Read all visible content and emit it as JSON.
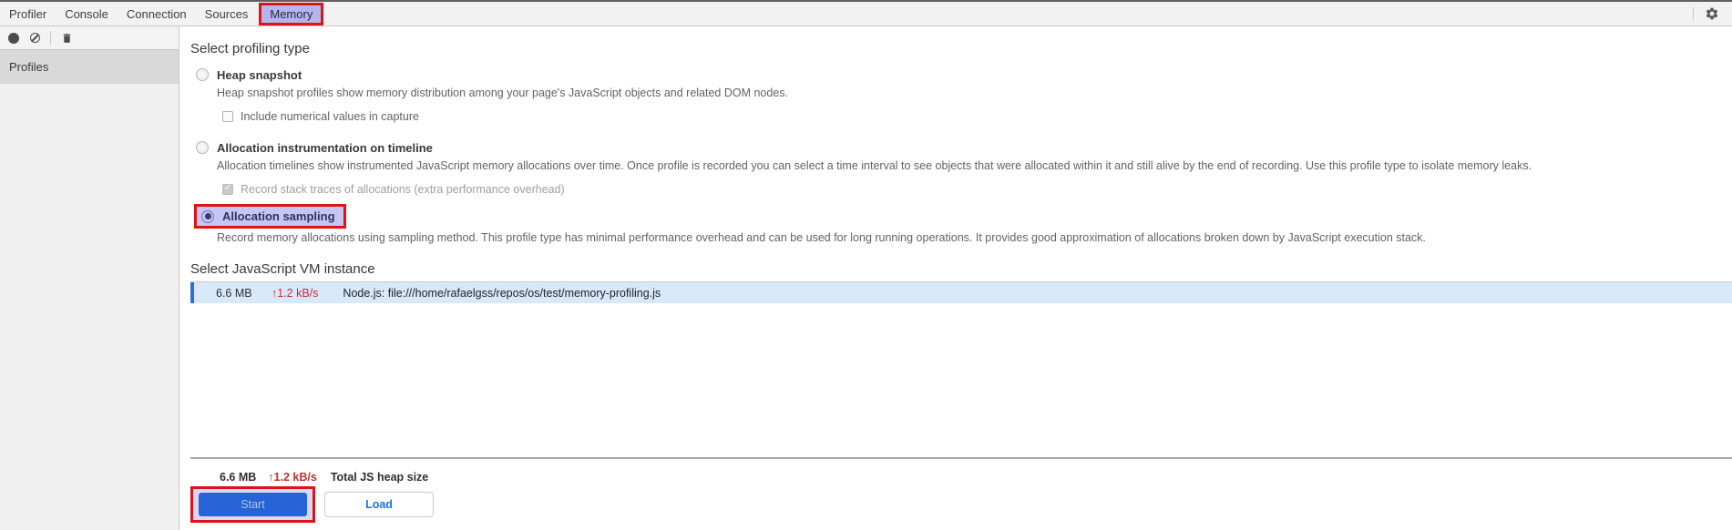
{
  "window": {
    "tabs": [
      "Profiler",
      "Console",
      "Connection",
      "Sources",
      "Memory"
    ],
    "active_tab": "Memory"
  },
  "sidebar": {
    "header": "Profiles"
  },
  "main": {
    "profiling": {
      "heading": "Select profiling type",
      "options": [
        {
          "label": "Heap snapshot",
          "description": "Heap snapshot profiles show memory distribution among your page's JavaScript objects and related DOM nodes.",
          "selected": false,
          "checkbox": {
            "label": "Include numerical values in capture",
            "checked": false
          }
        },
        {
          "label": "Allocation instrumentation on timeline",
          "description": "Allocation timelines show instrumented JavaScript memory allocations over time. Once profile is recorded you can select a time interval to see objects that were allocated within it and still alive by the end of recording. Use this profile type to isolate memory leaks.",
          "selected": false,
          "checkbox": {
            "label": "Record stack traces of allocations (extra performance overhead)",
            "checked": true,
            "disabled": true
          }
        },
        {
          "label": "Allocation sampling",
          "description": "Record memory allocations using sampling method. This profile type has minimal performance overhead and can be used for long running operations. It provides good approximation of allocations broken down by JavaScript execution stack.",
          "selected": true
        }
      ]
    },
    "vm_instance": {
      "heading": "Select JavaScript VM instance",
      "rows": [
        {
          "heap_size": "6.6 MB",
          "rate": "↑1.2 kB/s",
          "name": "Node.js: file:///home/rafaelgss/repos/os/test/memory-profiling.js",
          "selected": true
        }
      ]
    },
    "footer": {
      "heap_size": "6.6 MB",
      "rate": "↑1.2 kB/s",
      "label": "Total JS heap size"
    },
    "actions": {
      "start_label": "Start",
      "load_label": "Load"
    }
  },
  "colors": {
    "annotation_red": "#e01313",
    "annotation_lavender": "#b5b5ee",
    "primary_button_blue": "#2563d6",
    "link_blue": "#1a73e8",
    "rate_red": "#c43030",
    "selected_row_bg": "#d8e8fb",
    "selected_row_accent": "#2e6edb",
    "tabbar_bg": "#f2f2f2",
    "profiles_header_bg": "#d9d9d9"
  }
}
